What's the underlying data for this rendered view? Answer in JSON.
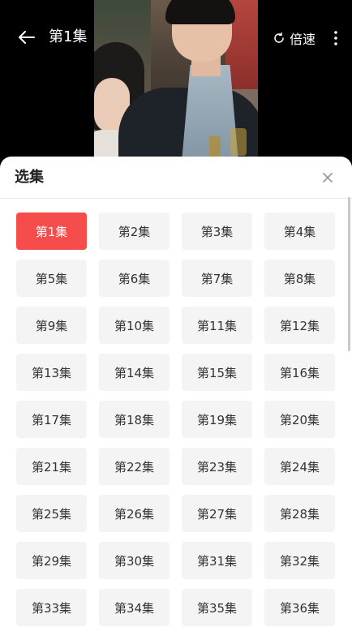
{
  "player": {
    "current_episode": "第1集",
    "speed_label": "倍速",
    "icons": {
      "back": "arrow-left-icon",
      "speed": "speed-icon",
      "more": "more-vertical-icon"
    }
  },
  "sheet": {
    "title": "选集",
    "close_icon": "close-icon",
    "active_index": 0,
    "accent_color": "#f64c4c",
    "episodes": [
      "第1集",
      "第2集",
      "第3集",
      "第4集",
      "第5集",
      "第6集",
      "第7集",
      "第8集",
      "第9集",
      "第10集",
      "第11集",
      "第12集",
      "第13集",
      "第14集",
      "第15集",
      "第16集",
      "第17集",
      "第18集",
      "第19集",
      "第20集",
      "第21集",
      "第22集",
      "第23集",
      "第24集",
      "第25集",
      "第26集",
      "第27集",
      "第28集",
      "第29集",
      "第30集",
      "第31集",
      "第32集",
      "第33集",
      "第34集",
      "第35集",
      "第36集"
    ]
  }
}
